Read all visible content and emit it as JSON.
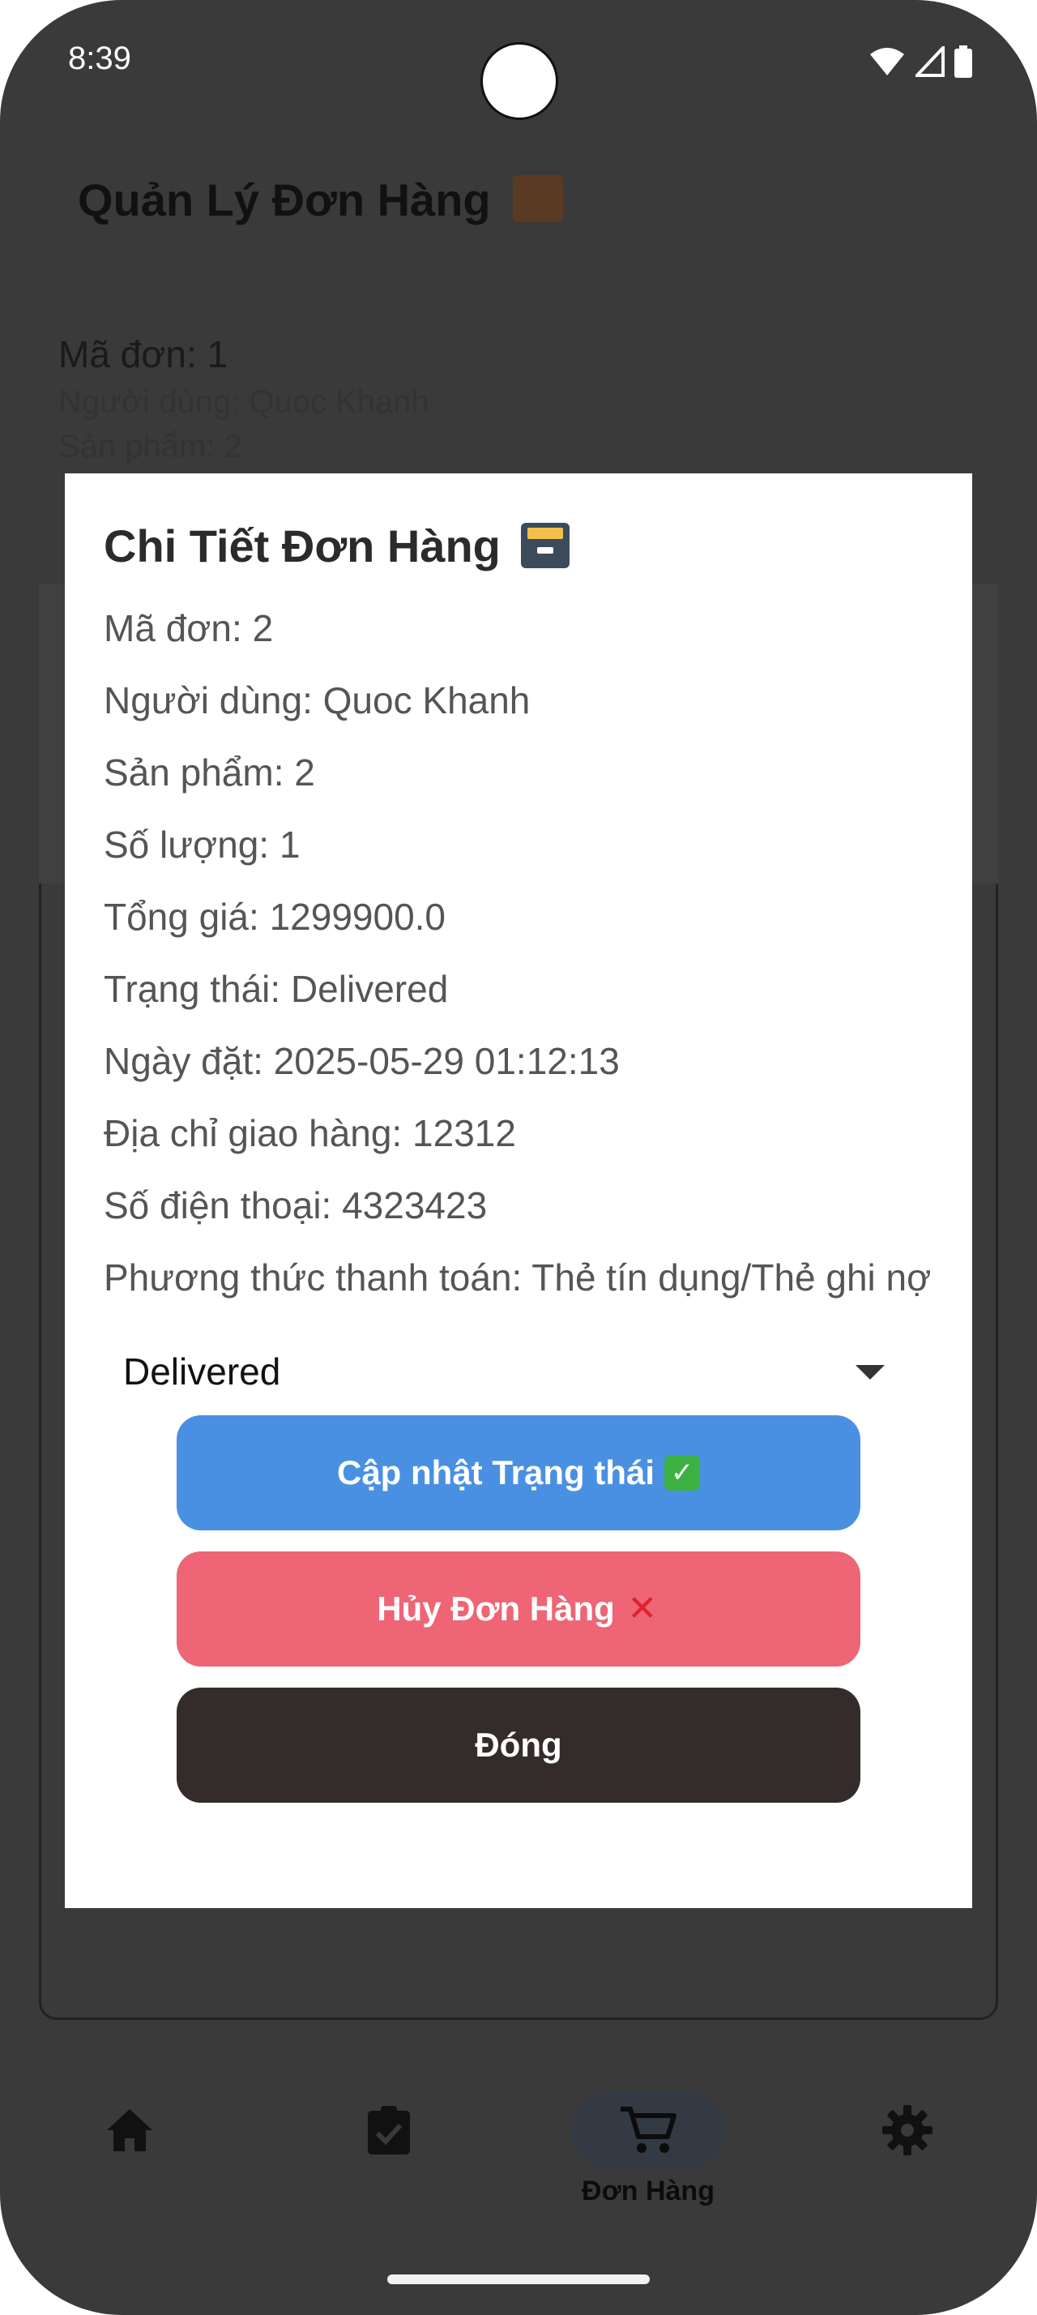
{
  "status_bar": {
    "time": "8:39"
  },
  "page": {
    "title": "Quản Lý Đơn Hàng",
    "title_icon": "package-icon",
    "background_order": {
      "id_line": "Mã đơn: 1",
      "user_line": "Người dùng: Quoc Khanh",
      "product_line": "Sản phẩm: 2"
    }
  },
  "modal": {
    "title": "Chi Tiết Đơn Hàng",
    "title_icon": "card-file-box-icon",
    "details": [
      "Mã đơn: 2",
      "Người dùng: Quoc Khanh",
      "Sản phẩm: 2",
      "Số lượng: 1",
      "Tổng giá: 1299900.0",
      "Trạng thái: Delivered",
      "Ngày đặt: 2025-05-29 01:12:13",
      "Địa chỉ giao hàng: 12312",
      "Số điện thoại: 4323423",
      "Phương thức thanh toán: Thẻ tín dụng/Thẻ ghi nợ"
    ],
    "status_select": {
      "value": "Delivered"
    },
    "buttons": {
      "update_label": "Cập nhật Trạng thái",
      "cancel_label": "Hủy Đơn Hàng",
      "close_label": "Đóng"
    }
  },
  "bottom_nav": {
    "items": [
      {
        "icon": "home-icon",
        "label": ""
      },
      {
        "icon": "clipboard-check-icon",
        "label": ""
      },
      {
        "icon": "cart-icon",
        "label": "Đơn Hàng"
      },
      {
        "icon": "gear-icon",
        "label": ""
      }
    ]
  },
  "colors": {
    "update_button": "#4a90e2",
    "cancel_button": "#ee6575",
    "close_button": "#332c2b",
    "scrim": "#3a3a3a"
  }
}
